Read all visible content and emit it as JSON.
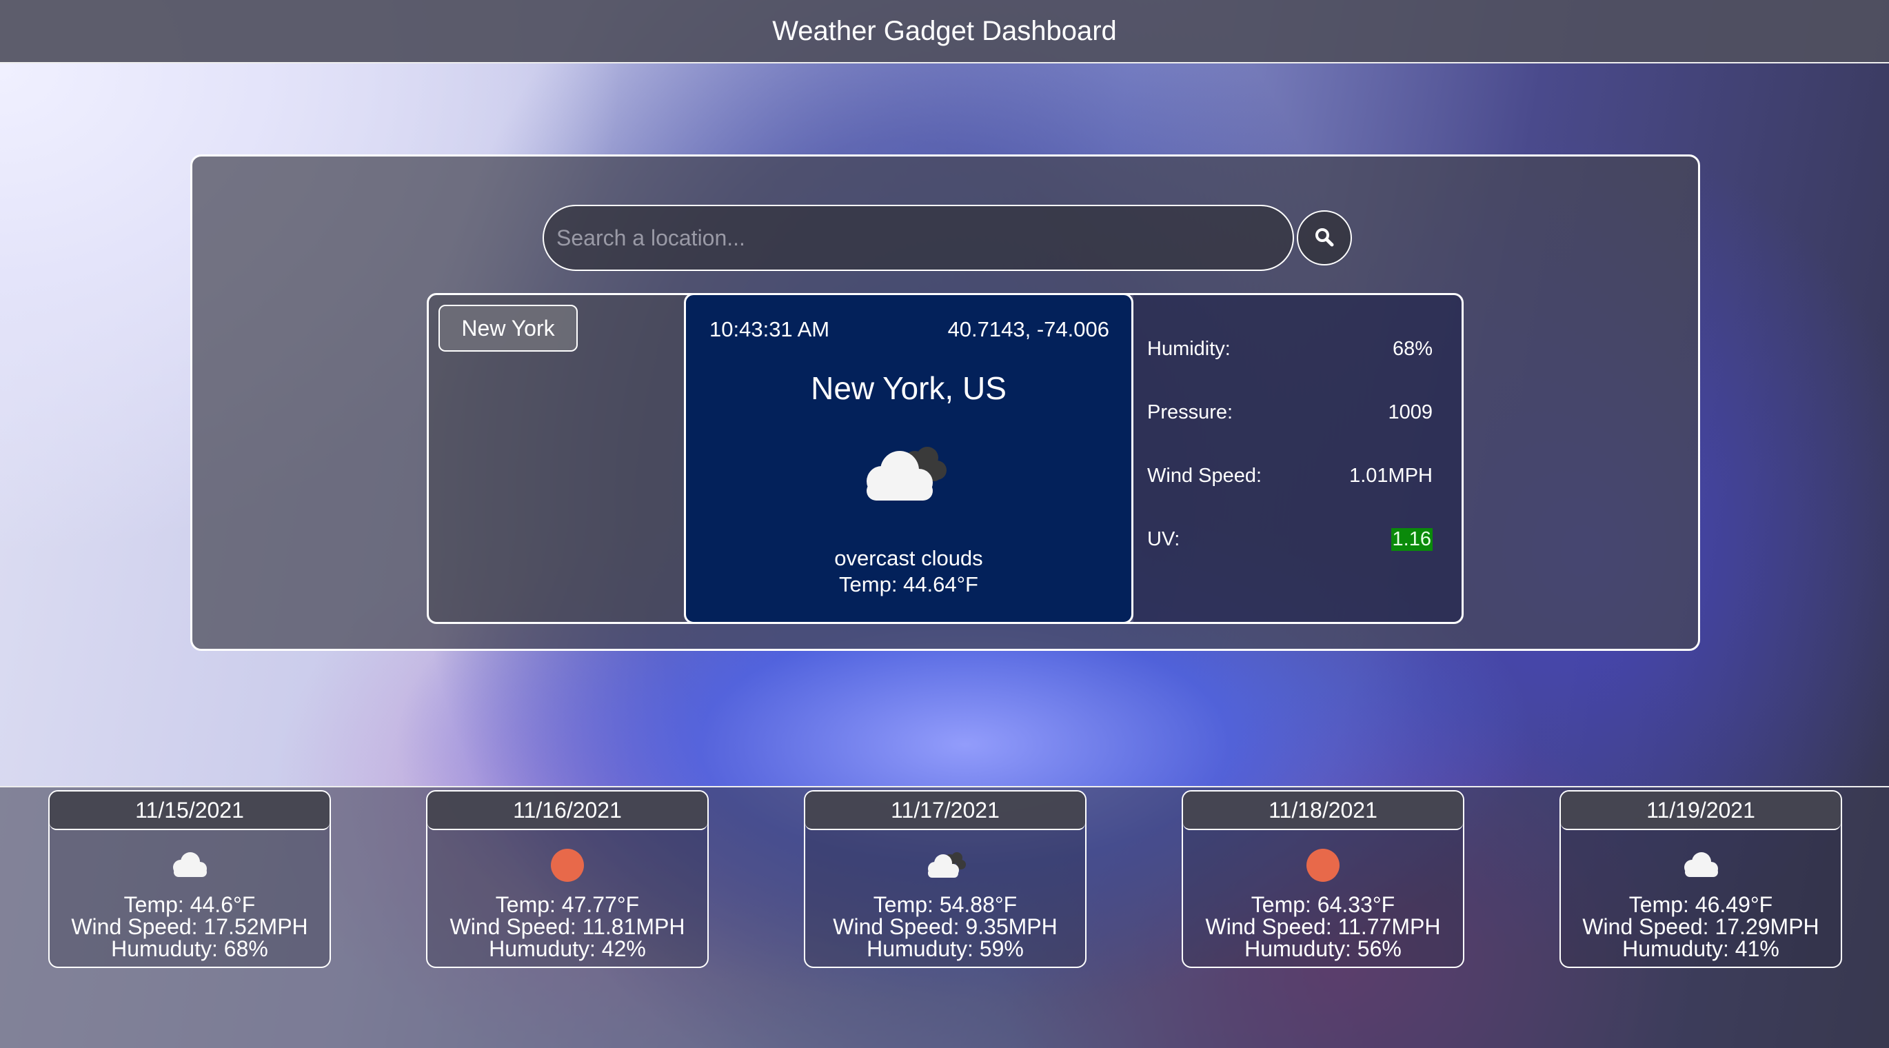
{
  "header": {
    "title": "Weather Gadget Dashboard"
  },
  "search": {
    "placeholder": "Search a location...",
    "value": ""
  },
  "history": [
    {
      "label": "New York"
    }
  ],
  "current": {
    "time": "10:43:31 AM",
    "coords": "40.7143, -74.006",
    "city": "New York, US",
    "icon": "overcast-cloud-icon",
    "description": "overcast clouds",
    "temp": "Temp: 44.64°F"
  },
  "stats": {
    "humidity_label": "Humidity:",
    "humidity_value": "68%",
    "pressure_label": "Pressure:",
    "pressure_value": "1009",
    "wind_label": "Wind Speed:",
    "wind_value": "1.01MPH",
    "uv_label": "UV:",
    "uv_value": "1.16",
    "uv_color": "#0a8a0a"
  },
  "forecast": [
    {
      "date": "11/15/2021",
      "icon": "cloud-icon",
      "temp": "Temp: 44.6°F",
      "wind": "Wind Speed: 17.52MPH",
      "humidity": "Humuduty: 68%"
    },
    {
      "date": "11/16/2021",
      "icon": "sun-icon",
      "temp": "Temp: 47.77°F",
      "wind": "Wind Speed: 11.81MPH",
      "humidity": "Humuduty: 42%"
    },
    {
      "date": "11/17/2021",
      "icon": "overcast-cloud-icon",
      "temp": "Temp: 54.88°F",
      "wind": "Wind Speed: 9.35MPH",
      "humidity": "Humuduty: 59%"
    },
    {
      "date": "11/18/2021",
      "icon": "sun-icon",
      "temp": "Temp: 64.33°F",
      "wind": "Wind Speed: 11.77MPH",
      "humidity": "Humuduty: 56%"
    },
    {
      "date": "11/19/2021",
      "icon": "cloud-icon",
      "temp": "Temp: 46.49°F",
      "wind": "Wind Speed: 17.29MPH",
      "humidity": "Humuduty: 41%"
    }
  ],
  "colors": {
    "current_card_bg": "#03215a",
    "sun": "#e8694a"
  }
}
